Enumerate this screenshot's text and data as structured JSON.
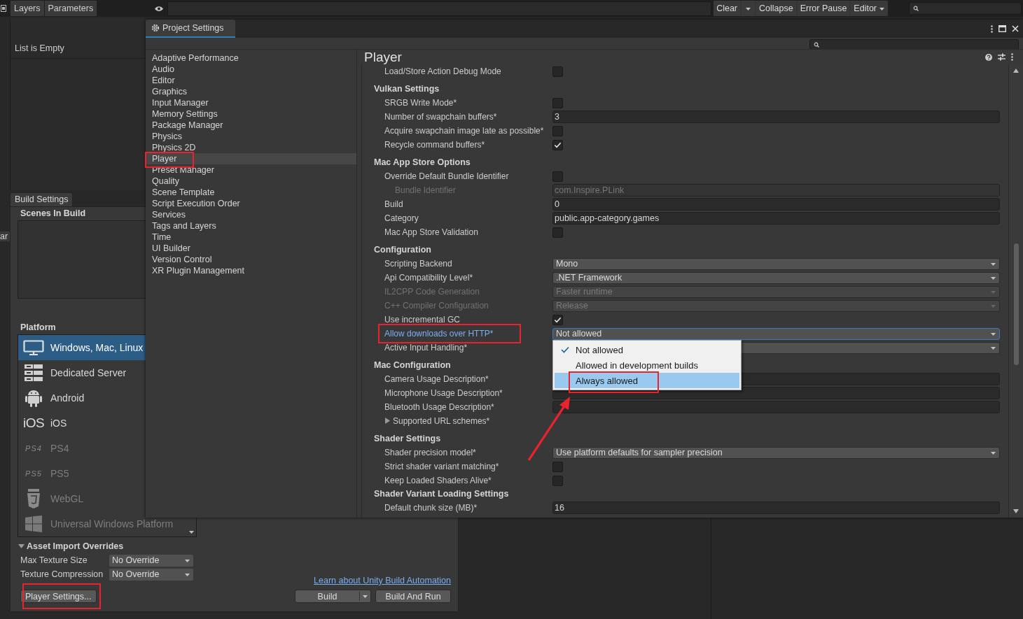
{
  "top_bar": {
    "panel_tabs": [
      "Layers",
      "Parameters"
    ],
    "console_buttons": [
      {
        "kind": "button",
        "label": "Clear"
      },
      {
        "kind": "caret"
      },
      {
        "kind": "button",
        "label": "Collapse"
      },
      {
        "kind": "button",
        "label": "Error Pause"
      },
      {
        "kind": "dropdown",
        "label": "Editor"
      }
    ]
  },
  "list_panel": {
    "empty_text": "List is Empty",
    "clipped_text": "ar"
  },
  "project_settings": {
    "title": "Project Settings",
    "categories": [
      {
        "label": "Adaptive Performance",
        "selected": false
      },
      {
        "label": "Audio",
        "selected": false
      },
      {
        "label": "Editor",
        "selected": false
      },
      {
        "label": "Graphics",
        "selected": false
      },
      {
        "label": "Input Manager",
        "selected": false
      },
      {
        "label": "Memory Settings",
        "selected": false
      },
      {
        "label": "Package Manager",
        "selected": false
      },
      {
        "label": "Physics",
        "selected": false
      },
      {
        "label": "Physics 2D",
        "selected": false
      },
      {
        "label": "Player",
        "selected": true
      },
      {
        "label": "Preset Manager",
        "selected": false
      },
      {
        "label": "Quality",
        "selected": false
      },
      {
        "label": "Scene Template",
        "selected": false
      },
      {
        "label": "Script Execution Order",
        "selected": false
      },
      {
        "label": "Services",
        "selected": false
      },
      {
        "label": "Tags and Layers",
        "selected": false
      },
      {
        "label": "Time",
        "selected": false
      },
      {
        "label": "UI Builder",
        "selected": false
      },
      {
        "label": "Version Control",
        "selected": false
      },
      {
        "label": "XR Plugin Management",
        "selected": false
      }
    ],
    "inspector": {
      "title": "Player",
      "sections": [
        {
          "rows": [
            {
              "kind": "checkbox",
              "label": "Load/Store Action Debug Mode",
              "checked": false,
              "disabled": false
            }
          ]
        },
        {
          "heading": "Vulkan Settings",
          "rows": [
            {
              "kind": "checkbox",
              "label": "SRGB Write Mode*",
              "checked": false,
              "disabled": false
            },
            {
              "kind": "text",
              "label": "Number of swapchain buffers*",
              "value": "3",
              "disabled": false
            },
            {
              "kind": "checkbox",
              "label": "Acquire swapchain image late as possible*",
              "checked": false,
              "disabled": false
            },
            {
              "kind": "checkbox",
              "label": "Recycle command buffers*",
              "checked": true,
              "disabled": false
            }
          ]
        },
        {
          "heading": "Mac App Store Options",
          "rows": [
            {
              "kind": "checkbox",
              "label": "Override Default Bundle Identifier",
              "checked": false,
              "disabled": false,
              "children": [
                {
                  "kind": "text",
                  "label": "Bundle Identifier",
                  "value": "com.Inspire.PLink",
                  "disabled": true
                }
              ]
            },
            {
              "kind": "text",
              "label": "Build",
              "value": "0",
              "disabled": false
            },
            {
              "kind": "text",
              "label": "Category",
              "value": "public.app-category.games",
              "disabled": false
            },
            {
              "kind": "checkbox",
              "label": "Mac App Store Validation",
              "checked": false,
              "disabled": false
            }
          ]
        },
        {
          "heading": "Configuration",
          "rows": [
            {
              "kind": "dropdown",
              "label": "Scripting Backend",
              "value": "Mono",
              "disabled": false,
              "focused": false
            },
            {
              "kind": "dropdown",
              "label": "Api Compatibility Level*",
              "value": ".NET Framework",
              "disabled": false,
              "focused": false
            },
            {
              "kind": "dropdown",
              "label": "IL2CPP Code Generation",
              "value": "Faster runtime",
              "disabled": true,
              "focused": false
            },
            {
              "kind": "dropdown",
              "label": "C++ Compiler Configuration",
              "value": "Release",
              "disabled": true,
              "focused": false
            },
            {
              "kind": "checkbox",
              "label": "Use incremental GC",
              "checked": true,
              "disabled": false
            },
            {
              "kind": "dropdown",
              "label": "Allow downloads over HTTP*",
              "value": "Not allowed",
              "disabled": false,
              "focused": true,
              "menu": [
                {
                  "label": "Not allowed",
                  "checked": true,
                  "highlighted": false
                },
                {
                  "label": "Allowed in development builds",
                  "checked": false,
                  "highlighted": false
                },
                {
                  "label": "Always allowed",
                  "checked": false,
                  "highlighted": true
                }
              ]
            },
            {
              "kind": "dropdown",
              "label": "Active Input Handling*",
              "disabled": false,
              "focused": false
            }
          ]
        },
        {
          "heading": "Mac Configuration",
          "rows": [
            {
              "kind": "text",
              "label": "Camera Usage Description*",
              "disabled": false
            },
            {
              "kind": "text",
              "label": "Microphone Usage Description*",
              "disabled": false
            },
            {
              "kind": "text",
              "label": "Bluetooth Usage Description*",
              "disabled": false
            },
            {
              "kind": "foldout",
              "label": "Supported URL schemes*",
              "expanded": false,
              "disabled": false
            }
          ]
        },
        {
          "heading": "Shader Settings",
          "rows": [
            {
              "kind": "dropdown",
              "label": "Shader precision model*",
              "value": "Use platform defaults for sampler precision",
              "disabled": false,
              "focused": false
            },
            {
              "kind": "checkbox",
              "label": "Strict shader variant matching*",
              "checked": false,
              "disabled": false
            },
            {
              "kind": "checkbox",
              "label": "Keep Loaded Shaders Alive*",
              "checked": false,
              "disabled": false
            }
          ]
        },
        {
          "heading": "Shader Variant Loading Settings",
          "rows": [
            {
              "kind": "text",
              "label": "Default chunk size (MB)*",
              "value": "16",
              "disabled": false
            }
          ]
        }
      ]
    }
  },
  "build_settings": {
    "title": "Build Settings",
    "scenes_heading": "Scenes In Build",
    "platform_heading": "Platform",
    "platforms": [
      {
        "kind": "monitor",
        "label": "Windows, Mac, Linux",
        "selected": true,
        "disabled": false
      },
      {
        "kind": "server",
        "label": "Dedicated Server",
        "selected": false,
        "disabled": false
      },
      {
        "kind": "android",
        "label": "Android",
        "selected": false,
        "disabled": false
      },
      {
        "kind": "logo",
        "logo": "iOS",
        "label": "iOS",
        "selected": false,
        "disabled": false
      },
      {
        "kind": "logo",
        "logo": "PS4",
        "label": "PS4",
        "selected": false,
        "disabled": true
      },
      {
        "kind": "logo",
        "logo": "PS5",
        "label": "PS5",
        "selected": false,
        "disabled": true
      },
      {
        "kind": "html5",
        "label": "WebGL",
        "selected": false,
        "disabled": true
      },
      {
        "kind": "windows",
        "label": "Universal Windows Platform",
        "selected": false,
        "disabled": true
      }
    ],
    "overrides": {
      "heading": "Asset Import Overrides",
      "expanded": true,
      "fields": [
        {
          "label": "Max Texture Size",
          "value": "No Override"
        },
        {
          "label": "Texture Compression",
          "value": "No Override"
        }
      ]
    },
    "player_settings_button": {
      "label": "Player Settings..."
    },
    "link": "Learn about Unity Build Automation",
    "build_button": "Build",
    "build_and_run_button": "Build And Run"
  }
}
